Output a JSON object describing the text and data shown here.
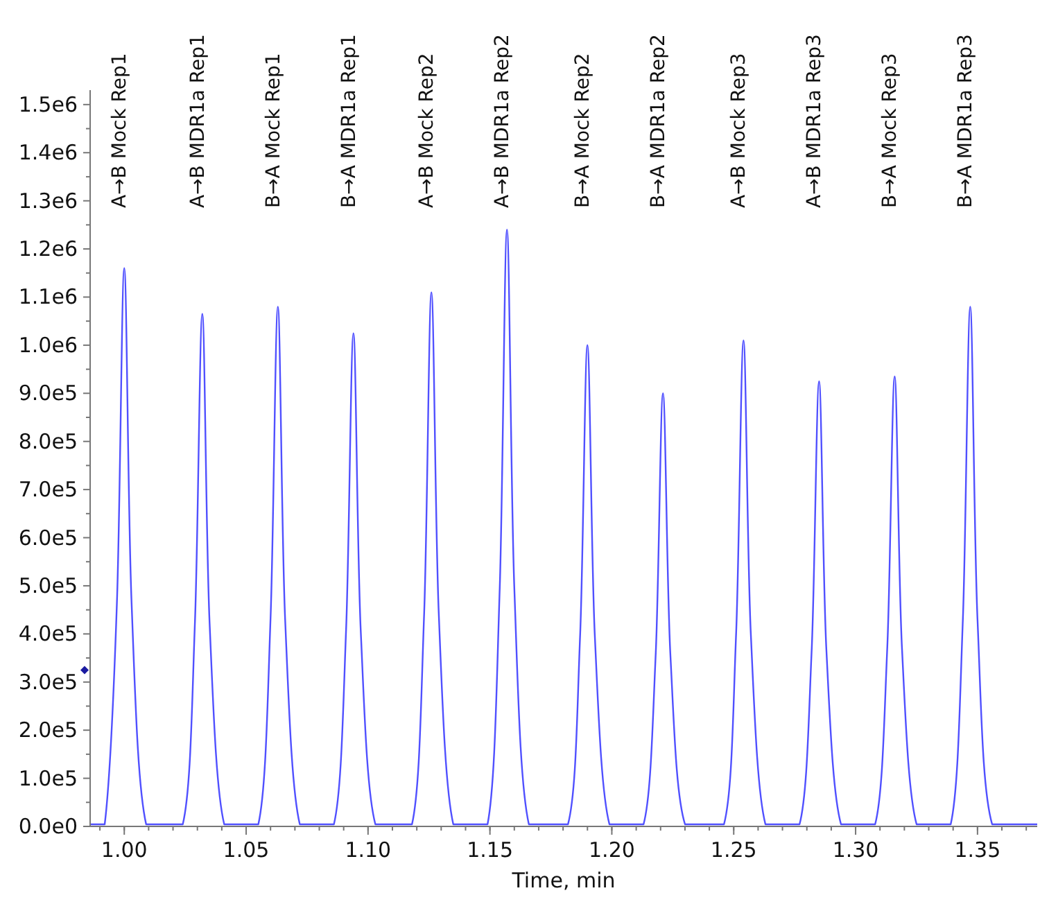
{
  "chart": {
    "chart_data": {
      "type": "line",
      "xlabel": "Time, min",
      "xlim": [
        0.986,
        1.3745
      ],
      "ylim": [
        0,
        1530000
      ],
      "xticks": [
        {
          "value": 1.0,
          "label": "1.00"
        },
        {
          "value": 1.05,
          "label": "1.05"
        },
        {
          "value": 1.1,
          "label": "1.10"
        },
        {
          "value": 1.15,
          "label": "1.15"
        },
        {
          "value": 1.2,
          "label": "1.20"
        },
        {
          "value": 1.25,
          "label": "1.25"
        },
        {
          "value": 1.3,
          "label": "1.30"
        },
        {
          "value": 1.35,
          "label": "1.35"
        }
      ],
      "yticks": [
        {
          "value": 0,
          "label": "0.0e0"
        },
        {
          "value": 100000,
          "label": "1.0e5"
        },
        {
          "value": 200000,
          "label": "2.0e5"
        },
        {
          "value": 300000,
          "label": "3.0e5"
        },
        {
          "value": 400000,
          "label": "4.0e5"
        },
        {
          "value": 500000,
          "label": "5.0e5"
        },
        {
          "value": 600000,
          "label": "6.0e5"
        },
        {
          "value": 700000,
          "label": "7.0e5"
        },
        {
          "value": 800000,
          "label": "8.0e5"
        },
        {
          "value": 900000,
          "label": "9.0e5"
        },
        {
          "value": 1000000,
          "label": "1.0e6"
        },
        {
          "value": 1100000,
          "label": "1.1e6"
        },
        {
          "value": 1200000,
          "label": "1.2e6"
        },
        {
          "value": 1300000,
          "label": "1.3e6"
        },
        {
          "value": 1400000,
          "label": "1.4e6"
        },
        {
          "value": 1500000,
          "label": "1.5e6"
        }
      ],
      "series": [
        {
          "color": "#5050ff",
          "x": [
            0.986,
            0.992,
            0.997,
            1.0,
            1.003,
            1.009,
            1.024,
            1.029,
            1.032,
            1.035,
            1.041,
            1.055,
            1.06,
            1.063,
            1.066,
            1.072,
            1.086,
            1.091,
            1.094,
            1.097,
            1.103,
            1.118,
            1.123,
            1.126,
            1.129,
            1.135,
            1.149,
            1.154,
            1.157,
            1.16,
            1.166,
            1.182,
            1.187,
            1.19,
            1.193,
            1.199,
            1.213,
            1.218,
            1.221,
            1.224,
            1.23,
            1.246,
            1.251,
            1.254,
            1.257,
            1.263,
            1.277,
            1.282,
            1.285,
            1.288,
            1.294,
            1.308,
            1.313,
            1.316,
            1.319,
            1.325,
            1.339,
            1.344,
            1.347,
            1.35,
            1.356,
            1.3745
          ],
          "values": [
            0,
            0,
            464000,
            1160000,
            464000,
            0,
            0,
            426000,
            1065000,
            426000,
            0,
            0,
            432000,
            1080000,
            432000,
            0,
            0,
            410000,
            1025000,
            410000,
            0,
            0,
            444000,
            1110000,
            444000,
            0,
            0,
            496000,
            1240000,
            496000,
            0,
            0,
            400000,
            1000000,
            400000,
            0,
            0,
            360000,
            900000,
            360000,
            0,
            0,
            404000,
            1010000,
            404000,
            0,
            0,
            370000,
            925000,
            370000,
            0,
            0,
            374000,
            935000,
            374000,
            0,
            0,
            432000,
            1080000,
            432000,
            0,
            0
          ]
        }
      ],
      "annotations": [
        "A→B Mock Rep1",
        "A→B MDR1a Rep1",
        "B→A Mock Rep1",
        "B→A MDR1a Rep1",
        "A→B Mock Rep2",
        "A→B MDR1a Rep2",
        "B→A Mock Rep2",
        "B→A MDR1a Rep2",
        "A→B Mock Rep3",
        "A→B MDR1a Rep3",
        "B→A Mock Rep3",
        "B→A MDR1a Rep3"
      ]
    }
  }
}
